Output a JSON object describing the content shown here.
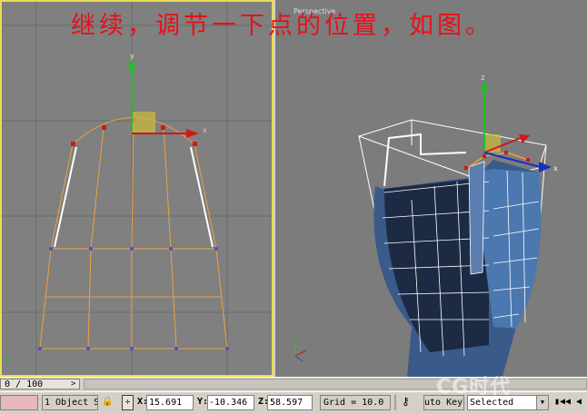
{
  "title": "继续，调节一下点的位置，如图。",
  "perspective_label": "Perspective",
  "timeline": {
    "frame": "0 / 100",
    "arrow": ">"
  },
  "status": {
    "selection": "1 Object S",
    "x_label": "X:",
    "x_value": "15.691",
    "y_label": "Y:",
    "y_value": "-10.346",
    "z_label": "Z:",
    "z_value": "58.597",
    "grid": "Grid = 10.0",
    "auto_key": "uto Key",
    "selected": "Selected",
    "prev_key_glyph": "▮◀◀",
    "play_glyph": "◀"
  },
  "watermark": "CG时代",
  "colors": {
    "accent": "#e8dc58",
    "title": "#e8101a",
    "wire": "#f0a040",
    "mesh": "#3a5a8a"
  },
  "icons": [
    "lock-icon",
    "key-icon",
    "axis-tripod-icon",
    "gizmo-icon"
  ]
}
